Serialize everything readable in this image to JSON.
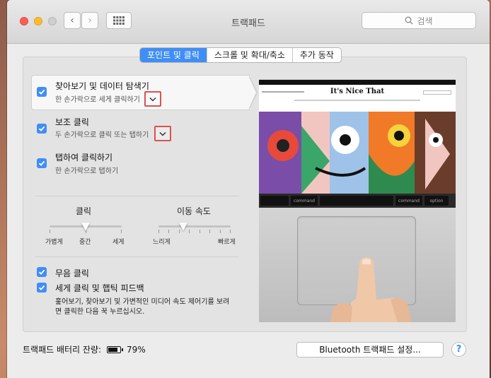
{
  "window": {
    "title": "트랙패드"
  },
  "search": {
    "placeholder": "검색"
  },
  "tabs": [
    {
      "label": "포인트 및 클릭",
      "active": true
    },
    {
      "label": "스크롤 및 확대/축소",
      "active": false
    },
    {
      "label": "추가 동작",
      "active": false
    }
  ],
  "features": [
    {
      "title": "찾아보기 및 데이터 탐색기",
      "subtitle": "한 손가락으로 세게 클릭하기",
      "checked": true
    },
    {
      "title": "보조 클릭",
      "subtitle": "두 손가락으로 클릭 또는 탭하기",
      "checked": true
    },
    {
      "title": "탭하여 클릭하기",
      "subtitle": "한 손가락으로 탭하기",
      "checked": true
    }
  ],
  "sliders": {
    "click": {
      "label": "클릭",
      "min_label": "가볍게",
      "mid_label": "중간",
      "max_label": "세게",
      "value": 0.5
    },
    "tracking": {
      "label": "이동 속도",
      "min_label": "느리게",
      "max_label": "빠르게",
      "value": 0.35
    }
  },
  "options": [
    {
      "title": "무음 클릭",
      "checked": true
    },
    {
      "title": "세게 클릭 및 햅틱 피드백",
      "description_line1": "훑어보기, 찾아보기 및 가변적인 미디어 속도 제어기를 보려",
      "description_line2": "면 클릭한 다음 꾹 누르십시오.",
      "checked": true
    }
  ],
  "preview": {
    "site_title": "It's Nice That",
    "key_labels": [
      "command",
      "command",
      "option"
    ]
  },
  "footer": {
    "battery_label": "트랙패드 배터리 잔량:",
    "battery_percent": "79%",
    "battery_level": 0.79,
    "bluetooth_button": "Bluetooth 트랙패드 설정...",
    "help": "?"
  },
  "colors": {
    "accent": "#3f8ef6",
    "highlight": "#d9534f"
  }
}
